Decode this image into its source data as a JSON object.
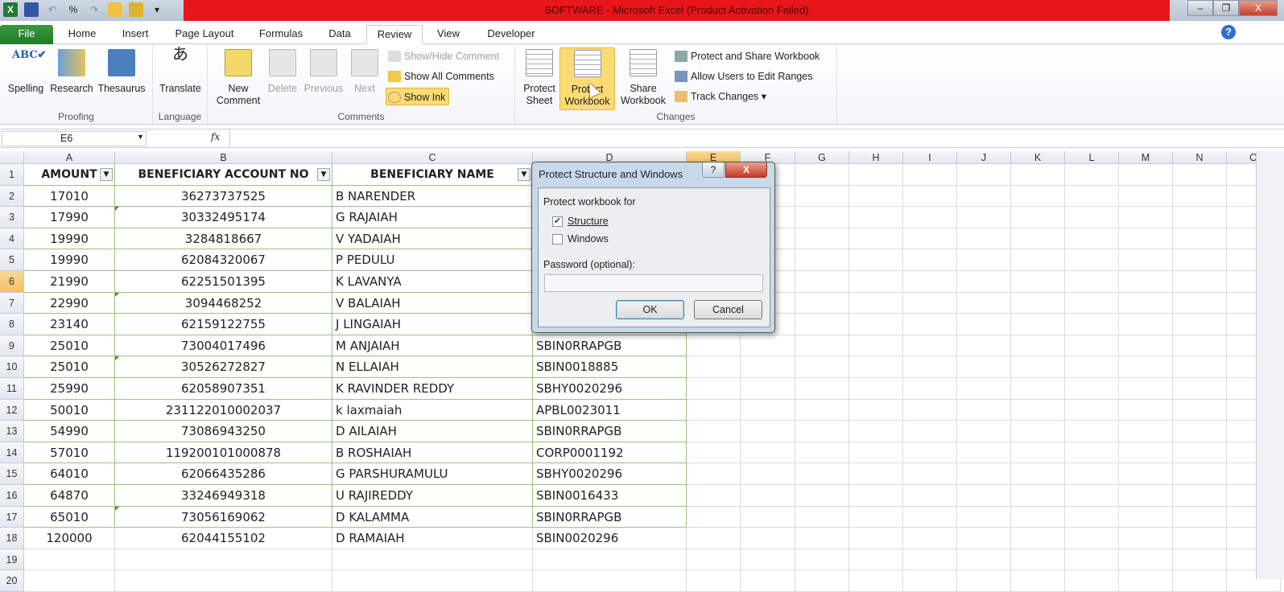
{
  "window": {
    "title": "SOFTWARE  -  Microsoft Excel (Product Activation Failed)",
    "minimize": "–",
    "restore": "❐",
    "close": "X"
  },
  "tabs": [
    "File",
    "Home",
    "Insert",
    "Page Layout",
    "Formulas",
    "Data",
    "Review",
    "View",
    "Developer"
  ],
  "active_tab": "Review",
  "ribbon": {
    "proofing": {
      "label": "Proofing",
      "spelling": "Spelling",
      "research": "Research",
      "thesaurus": "Thesaurus"
    },
    "language": {
      "label": "Language",
      "translate": "Translate"
    },
    "comments": {
      "label": "Comments",
      "new1": "New",
      "new2": "Comment",
      "delete": "Delete",
      "previous": "Previous",
      "next": "Next",
      "show_hide": "Show/Hide Comment",
      "show_all": "Show All Comments",
      "show_ink": "Show Ink"
    },
    "changes": {
      "label": "Changes",
      "protect_sheet1": "Protect",
      "protect_sheet2": "Sheet",
      "protect_wb1": "Protect",
      "protect_wb2": "Workbook",
      "share1": "Share",
      "share2": "Workbook",
      "protect_share": "Protect and Share Workbook",
      "allow_users": "Allow Users to Edit Ranges",
      "track_changes": "Track Changes ▾"
    }
  },
  "formula_bar": {
    "name_box": "E6",
    "fx": "fx",
    "value": ""
  },
  "columns": [
    "A",
    "B",
    "C",
    "D",
    "E",
    "F",
    "G",
    "H",
    "I",
    "J",
    "K",
    "L",
    "M",
    "N",
    "O"
  ],
  "selected_column": "E",
  "selected_row": 6,
  "headers": [
    "AMOUNT",
    "BENEFICIARY ACCOUNT NO",
    "BENEFICIARY NAME"
  ],
  "rows": [
    [
      "17010",
      "36273737525",
      "B NARENDER",
      ""
    ],
    [
      "17990",
      "30332495174",
      "G RAJAIAH",
      ""
    ],
    [
      "19990",
      "3284818667",
      "V YADAIAH",
      ""
    ],
    [
      "19990",
      "62084320067",
      "P PEDULU",
      ""
    ],
    [
      "21990",
      "62251501395",
      "K LAVANYA",
      ""
    ],
    [
      "22990",
      "3094468252",
      "V BALAIAH",
      ""
    ],
    [
      "23140",
      "62159122755",
      "J LINGAIAH",
      ""
    ],
    [
      "25010",
      "73004017496",
      "M ANJAIAH",
      "SBIN0RRAPGB"
    ],
    [
      "25010",
      "30526272827",
      "N ELLAIAH",
      "SBIN0018885"
    ],
    [
      "25990",
      "62058907351",
      "K RAVINDER REDDY",
      "SBHY0020296"
    ],
    [
      "50010",
      "231122010002037",
      "k laxmaiah",
      "APBL0023011"
    ],
    [
      "54990",
      "73086943250",
      "D AILAIAH",
      "SBIN0RRAPGB"
    ],
    [
      "57010",
      "119200101000878",
      "B ROSHAIAH",
      "CORP0001192"
    ],
    [
      "64010",
      "62066435286",
      "G PARSHURAMULU",
      "SBHY0020296"
    ],
    [
      "64870",
      "33246949318",
      "U RAJIREDDY",
      "SBIN0016433"
    ],
    [
      "65010",
      "73056169062",
      "D KALAMMA",
      "SBIN0RRAPGB"
    ],
    [
      "120000",
      "62044155102",
      "D RAMAIAH",
      "SBIN0020296"
    ]
  ],
  "dialog": {
    "title": "Protect Structure and Windows",
    "help": "?",
    "close": "X",
    "group_label": "Protect workbook for",
    "structure": "Structure",
    "structure_checked": true,
    "windows": "Windows",
    "windows_checked": false,
    "password_label": "Password (optional):",
    "password": "",
    "ok": "OK",
    "cancel": "Cancel"
  }
}
